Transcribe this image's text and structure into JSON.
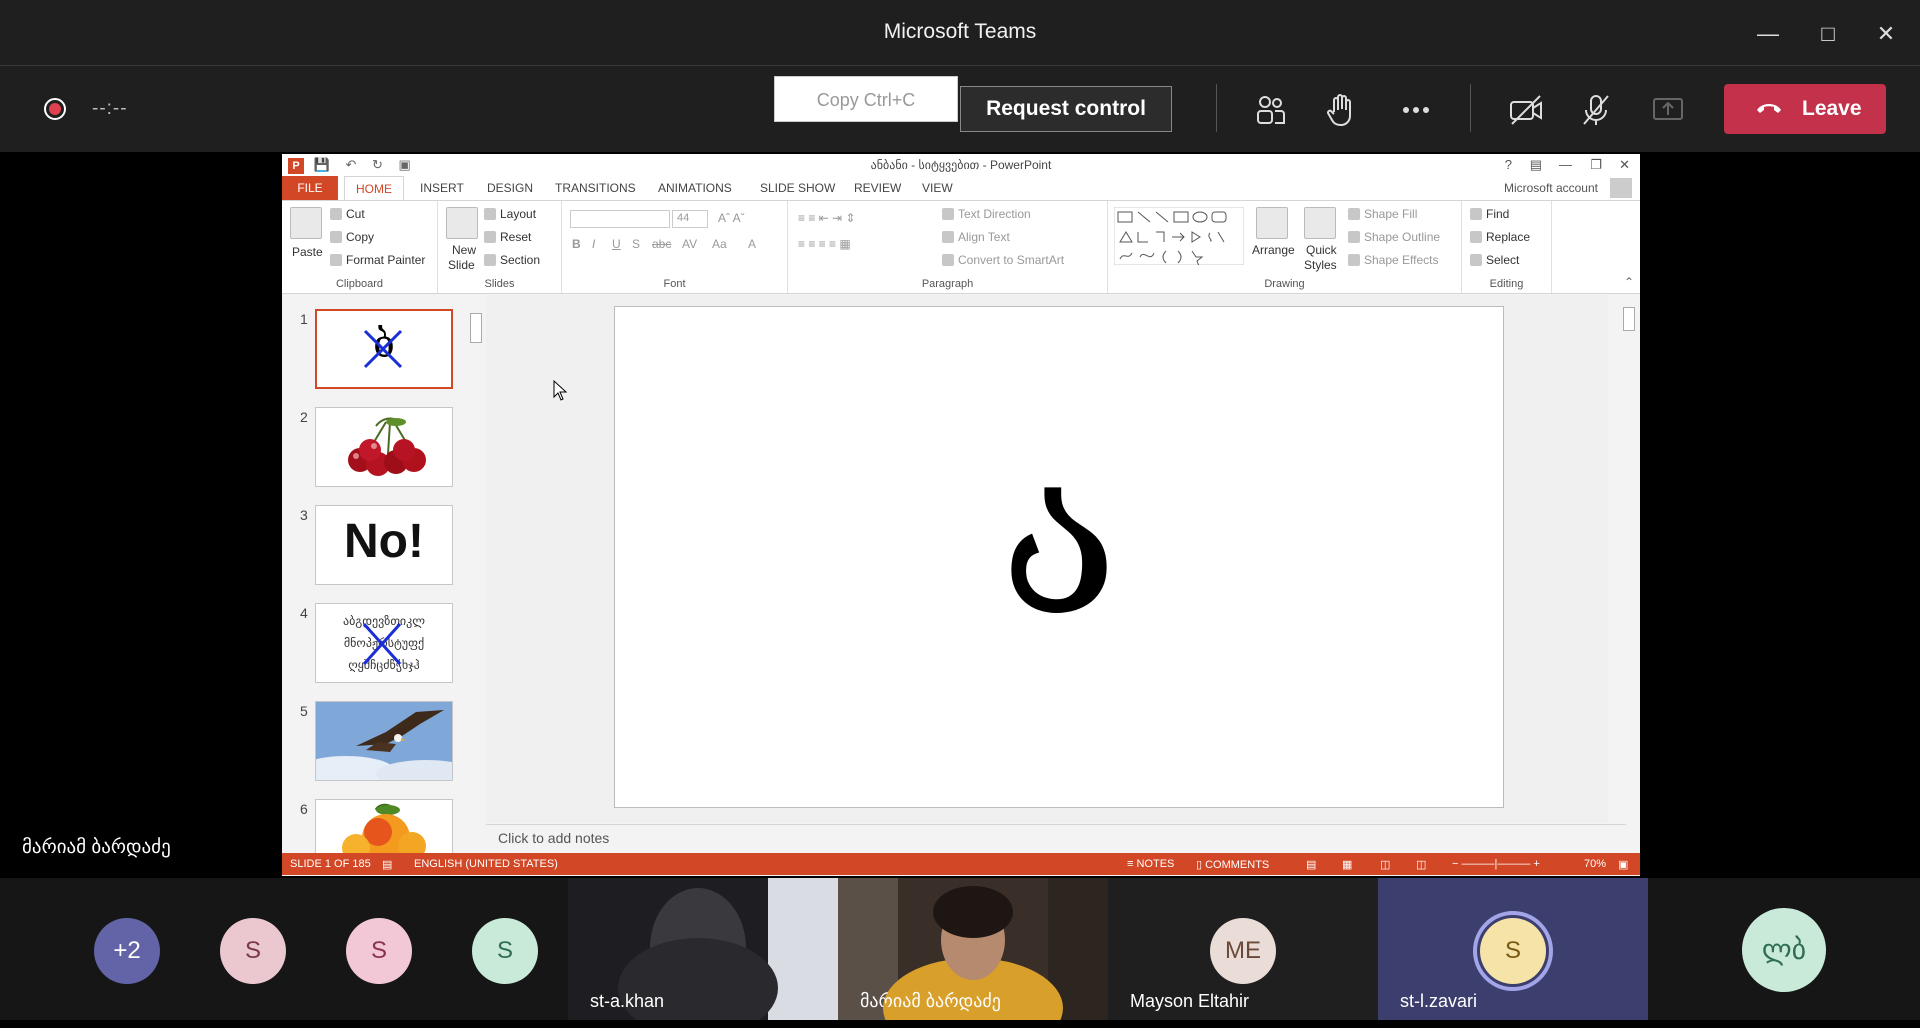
{
  "window": {
    "title": "Microsoft Teams"
  },
  "meeting": {
    "timer": "--:--",
    "copy_tooltip": "Copy   Ctrl+C",
    "request_control": "Request control",
    "leave": "Leave",
    "presenter_name": "მარიამ ბარდაძე"
  },
  "ppt": {
    "title": "ანბანი - სიტყვებით - PowerPoint",
    "tabs": [
      "FILE",
      "HOME",
      "INSERT",
      "DESIGN",
      "TRANSITIONS",
      "ANIMATIONS",
      "SLIDE SHOW",
      "REVIEW",
      "VIEW"
    ],
    "account": "Microsoft account",
    "ribbon": {
      "clipboard": {
        "label": "Clipboard",
        "paste": "Paste",
        "cut": "Cut",
        "copy": "Copy",
        "format_painter": "Format Painter"
      },
      "slides": {
        "label": "Slides",
        "new_slide_1": "New",
        "new_slide_2": "Slide",
        "layout": "Layout",
        "reset": "Reset",
        "section": "Section"
      },
      "font": {
        "label": "Font",
        "size": "44"
      },
      "paragraph": {
        "label": "Paragraph",
        "text_direction": "Text Direction",
        "align_text": "Align Text",
        "convert": "Convert to SmartArt"
      },
      "drawing": {
        "label": "Drawing",
        "arrange": "Arrange",
        "quick_1": "Quick",
        "quick_2": "Styles",
        "shape_fill": "Shape Fill",
        "shape_outline": "Shape Outline",
        "shape_effects": "Shape Effects"
      },
      "editing": {
        "label": "Editing",
        "find": "Find",
        "replace": "Replace",
        "select": "Select"
      }
    },
    "thumbnails": [
      {
        "num": "1",
        "desc": "letter-crossed"
      },
      {
        "num": "2",
        "desc": "cherries"
      },
      {
        "num": "3",
        "text": "No!"
      },
      {
        "num": "4",
        "desc": "alphabet-crossed"
      },
      {
        "num": "5",
        "desc": "eagle"
      },
      {
        "num": "6",
        "desc": "peach"
      }
    ],
    "slide_letter": "ა",
    "thumb1_letter": "ბ",
    "thumb4_letters": "აბგდევზთიკლ მნოპჟრსტუფქ ღყშჩცძწჭხჯჰ",
    "notes_placeholder": "Click to add notes",
    "status": {
      "slide": "SLIDE 1 OF 185",
      "language": "ENGLISH (UNITED STATES)",
      "notes": "NOTES",
      "comments": "COMMENTS",
      "zoom": "70%"
    }
  },
  "participants": {
    "avatars": [
      {
        "initials": "+2",
        "bg": "#6264a7",
        "fg": "#ffffff"
      },
      {
        "initials": "S",
        "bg": "#ebc8cf",
        "fg": "#7a3848"
      },
      {
        "initials": "S",
        "bg": "#f2c8d6",
        "fg": "#8a3350"
      },
      {
        "initials": "S",
        "bg": "#c9ead9",
        "fg": "#2f6e4f"
      }
    ],
    "tiles": [
      {
        "name": "st-a.khan"
      },
      {
        "name": "მარიამ ბარდაძე"
      },
      {
        "name": "Mayson Eltahir",
        "initials": "ME"
      },
      {
        "name": "st-l.zavari",
        "initials": "S"
      },
      {
        "initials": "ლბ"
      }
    ]
  },
  "colors": {
    "accent_ppt": "#d24726",
    "leave_red": "#c4314b",
    "teams_purple": "#6264a7"
  }
}
